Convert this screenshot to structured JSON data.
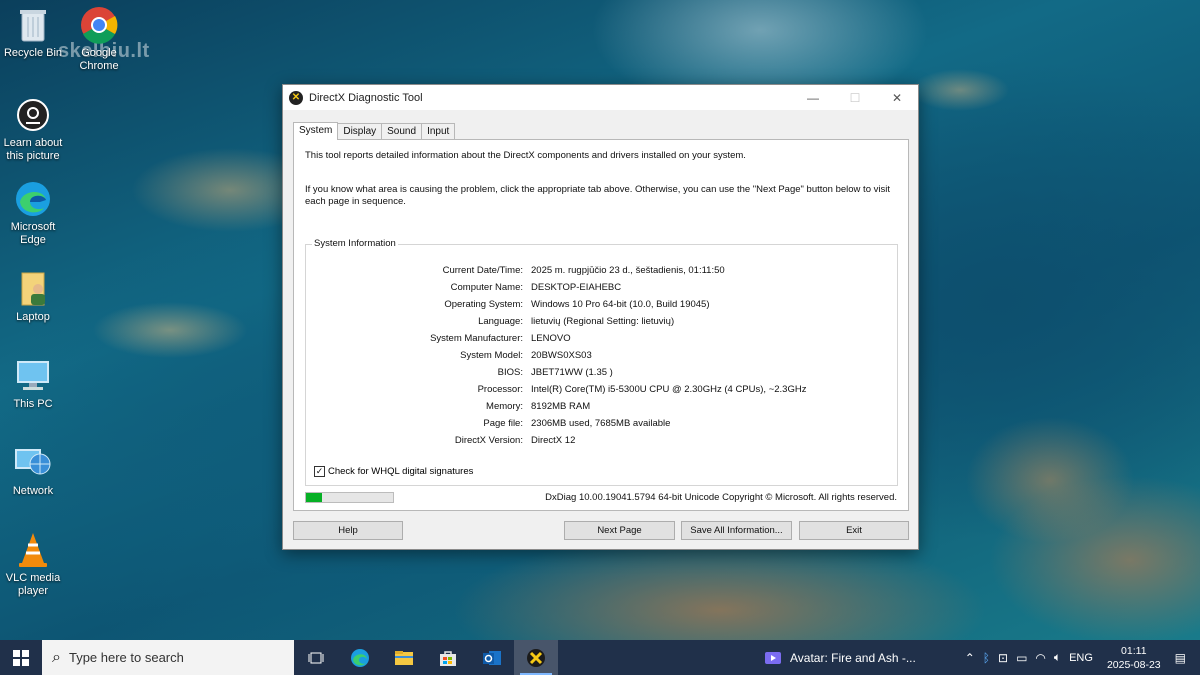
{
  "watermark": "skelbiu.lt",
  "desktop_icons": [
    {
      "label": "Recycle Bin"
    },
    {
      "label": "Google Chrome"
    },
    {
      "label": "Learn about this picture"
    },
    {
      "label": "Microsoft Edge"
    },
    {
      "label": "Laptop"
    },
    {
      "label": "This PC"
    },
    {
      "label": "Network"
    },
    {
      "label": "VLC media player"
    }
  ],
  "dialog": {
    "title": "DirectX Diagnostic Tool",
    "tabs": [
      {
        "label": "System",
        "active": true
      },
      {
        "label": "Display"
      },
      {
        "label": "Sound"
      },
      {
        "label": "Input"
      }
    ],
    "intro1": "This tool reports detailed information about the DirectX components and drivers installed on your system.",
    "intro2": "If you know what area is causing the problem, click the appropriate tab above.  Otherwise, you can use the \"Next Page\" button below to visit each page in sequence.",
    "group_title": "System Information",
    "rows": [
      {
        "label": "Current Date/Time:",
        "value": "2025 m. rugpjūčio 23 d., šeštadienis, 01:11:50"
      },
      {
        "label": "Computer Name:",
        "value": "DESKTOP-EIAHEBC"
      },
      {
        "label": "Operating System:",
        "value": "Windows 10 Pro 64-bit (10.0, Build 19045)"
      },
      {
        "label": "Language:",
        "value": "lietuvių (Regional Setting: lietuvių)"
      },
      {
        "label": "System Manufacturer:",
        "value": "LENOVO"
      },
      {
        "label": "System Model:",
        "value": "20BWS0XS03"
      },
      {
        "label": "BIOS:",
        "value": "JBET71WW (1.35 )"
      },
      {
        "label": "Processor:",
        "value": "Intel(R) Core(TM) i5-5300U CPU @ 2.30GHz (4 CPUs), ~2.3GHz"
      },
      {
        "label": "Memory:",
        "value": "8192MB RAM"
      },
      {
        "label": "Page file:",
        "value": "2306MB used, 7685MB available"
      },
      {
        "label": "DirectX Version:",
        "value": "DirectX 12"
      }
    ],
    "whql_label": "Check for WHQL digital signatures",
    "whql_checked": true,
    "progress_fraction": 0.18,
    "copyright": "DxDiag 10.00.19041.5794 64-bit Unicode  Copyright © Microsoft. All rights reserved.",
    "buttons": {
      "help": "Help",
      "next_page": "Next Page",
      "save_all": "Save All Information...",
      "exit": "Exit"
    }
  },
  "taskbar": {
    "search_placeholder": "Type here to search",
    "media_title": "Avatar: Fire and Ash -...",
    "language": "ENG",
    "time": "01:11",
    "date": "2025-08-23"
  },
  "colors": {
    "progress_green": "#06b025",
    "taskbar_bg": "#20304a"
  }
}
